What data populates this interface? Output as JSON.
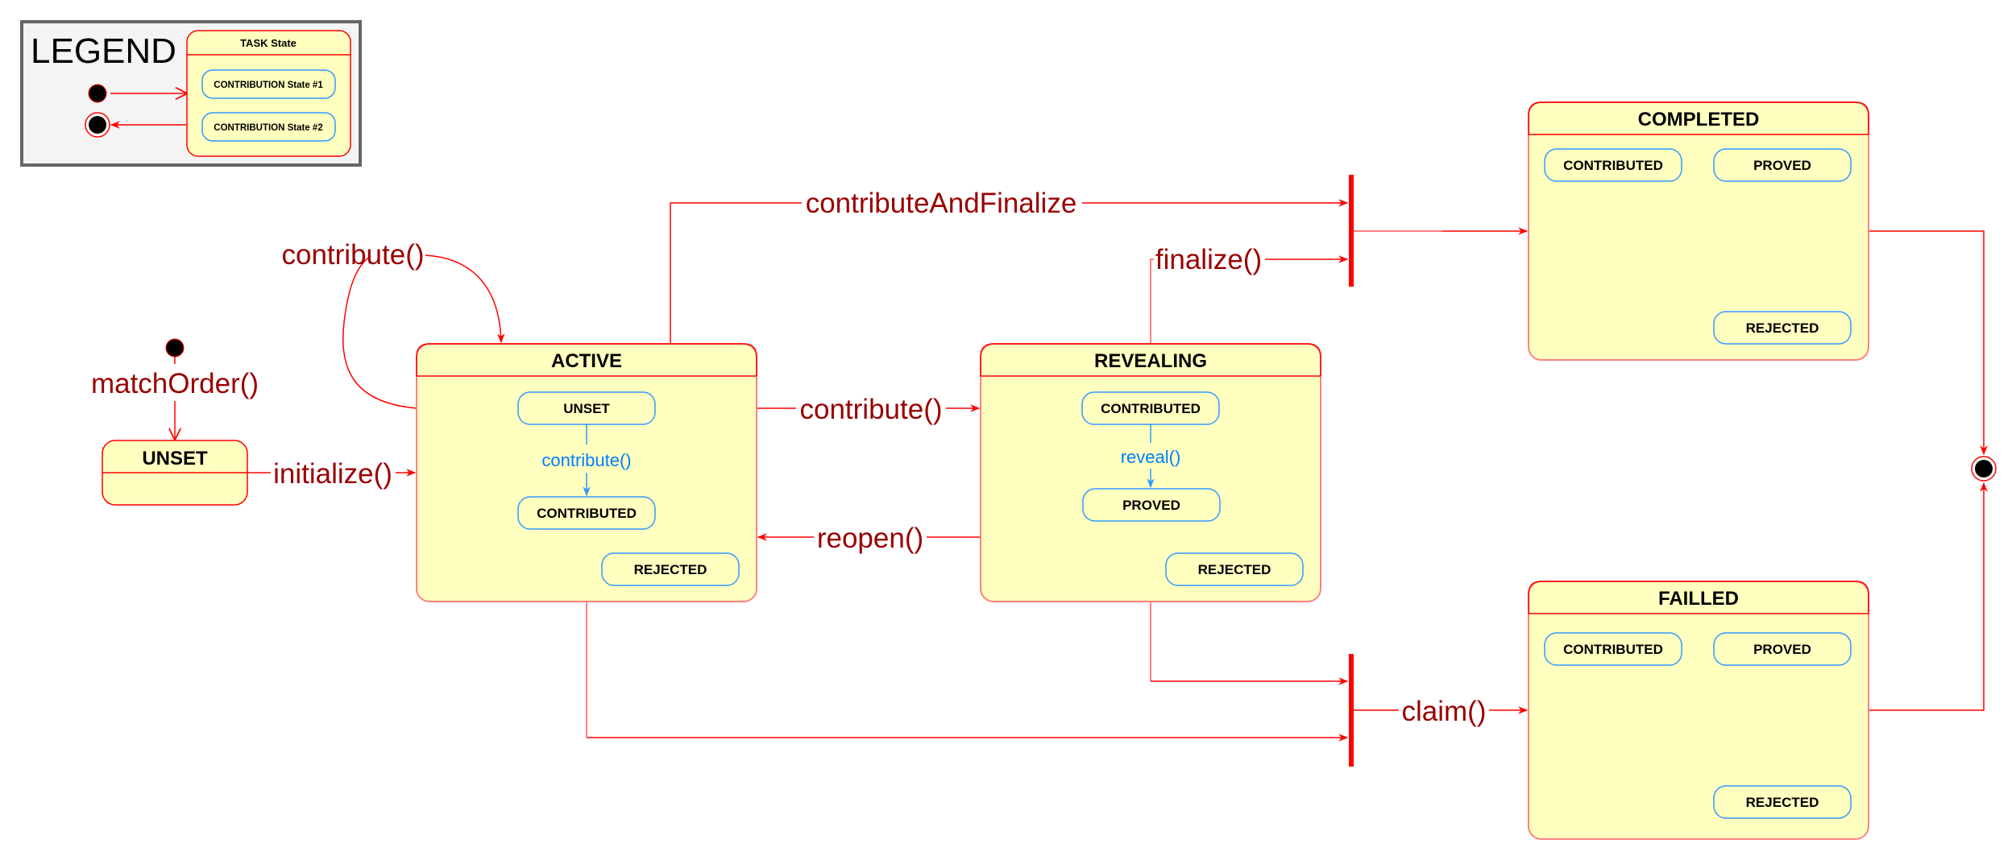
{
  "legend": {
    "title": "LEGEND",
    "task_state_label": "TASK State",
    "contribution_state_1": "CONTRIBUTION State #1",
    "contribution_state_2": "CONTRIBUTION State #2",
    "initial_icon": "initial-state-icon",
    "final_icon": "final-state-icon"
  },
  "states": {
    "unset": {
      "title": "UNSET"
    },
    "active": {
      "title": "ACTIVE",
      "sub": [
        "UNSET",
        "CONTRIBUTED",
        "REJECTED"
      ],
      "inner_transition": "contribute()"
    },
    "revealing": {
      "title": "REVEALING",
      "sub": [
        "CONTRIBUTED",
        "PROVED",
        "REJECTED"
      ],
      "inner_transition": "reveal()"
    },
    "completed": {
      "title": "COMPLETED",
      "sub": [
        "CONTRIBUTED",
        "PROVED",
        "REJECTED"
      ]
    },
    "failled": {
      "title": "FAILLED",
      "sub": [
        "CONTRIBUTED",
        "PROVED",
        "REJECTED"
      ]
    }
  },
  "transitions": {
    "match_order": "matchOrder()",
    "initialize": "initialize()",
    "contribute_self": "contribute()",
    "contribute_and_finalize": "contributeAndFinalize",
    "contribute": "contribute()",
    "reopen": "reopen()",
    "finalize": "finalize()",
    "claim": "claim()"
  },
  "colors": {
    "state_fill": "#FFFFC0",
    "state_stroke": "#FF0000",
    "substate_stroke": "#3399FF",
    "transition_label": "#990000",
    "inner_transition_label": "#007FFF",
    "legend_bg": "#F4F4F4"
  }
}
